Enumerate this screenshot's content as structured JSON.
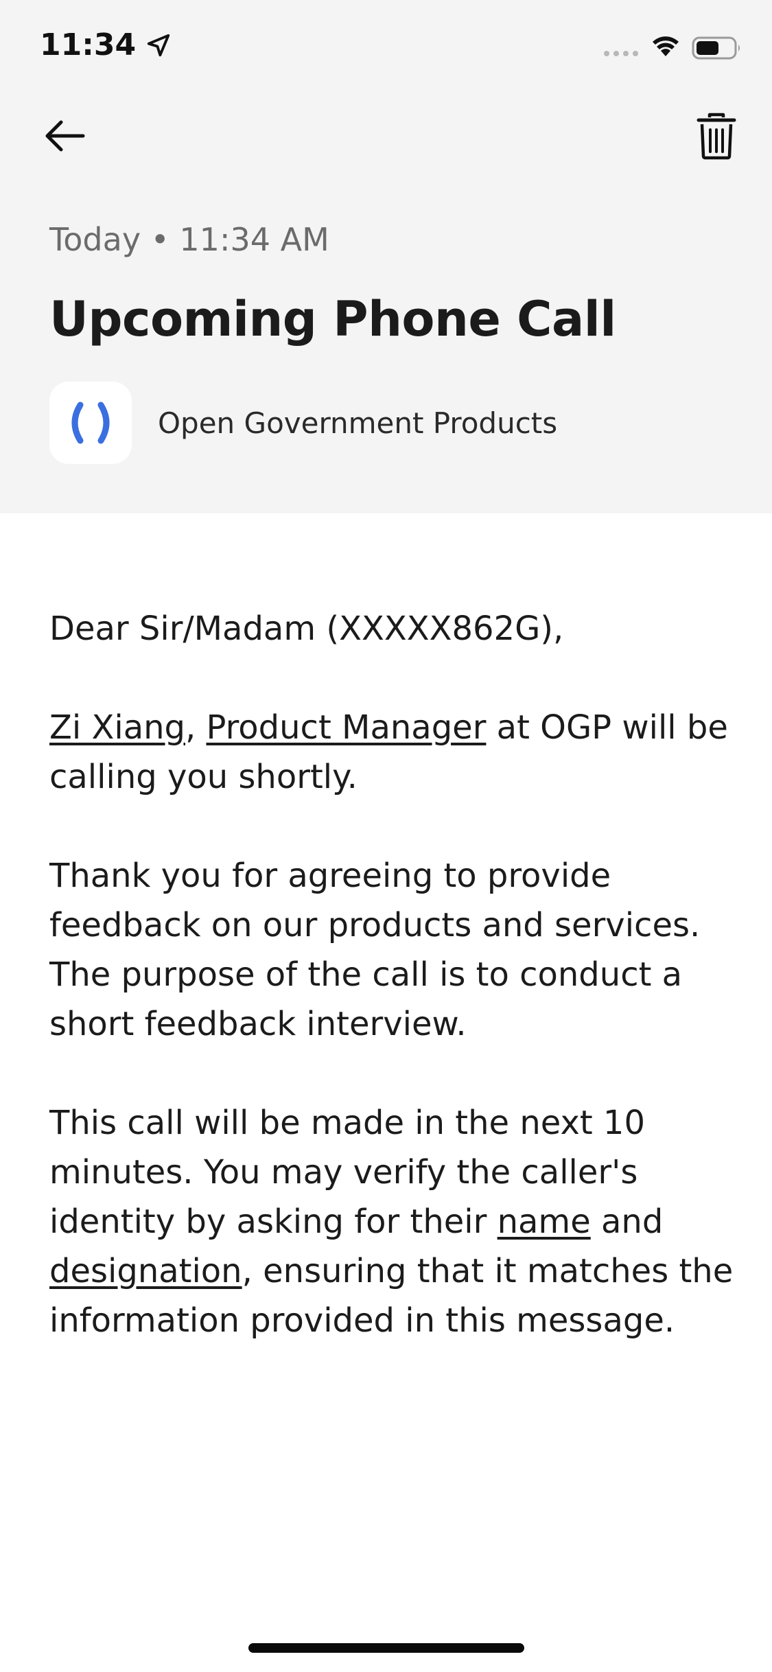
{
  "status_bar": {
    "time": "11:34"
  },
  "header": {
    "timestamp": "Today • 11:34 AM",
    "title": "Upcoming Phone Call",
    "sender": "Open Government Products"
  },
  "message": {
    "greeting": "Dear Sir/Madam (XXXXX862G),",
    "caller_name": "Zi Xiang",
    "comma": ", ",
    "caller_role": "Product Manager",
    "p2_rest": " at OGP will be calling you shortly.",
    "p3": "Thank you for agreeing to provide feedback on our products and services. The purpose of the call is to conduct a short feedback interview.",
    "p4_a": "This call will be made in the next 10 minutes. You may verify the caller's identity by asking for their ",
    "p4_name": "name",
    "p4_and": " and ",
    "p4_designation": "designation",
    "p4_b": ", ensuring that it matches the information provided in this message."
  },
  "icons": {
    "back": "arrow-left-icon",
    "delete": "trash-icon",
    "location": "location-arrow-icon",
    "wifi": "wifi-icon",
    "battery": "battery-icon",
    "logo": "ogp-logo-icon"
  },
  "colors": {
    "header_bg": "#f4f4f4",
    "brand_blue": "#3b6fe0",
    "text": "#1b1b1b"
  }
}
